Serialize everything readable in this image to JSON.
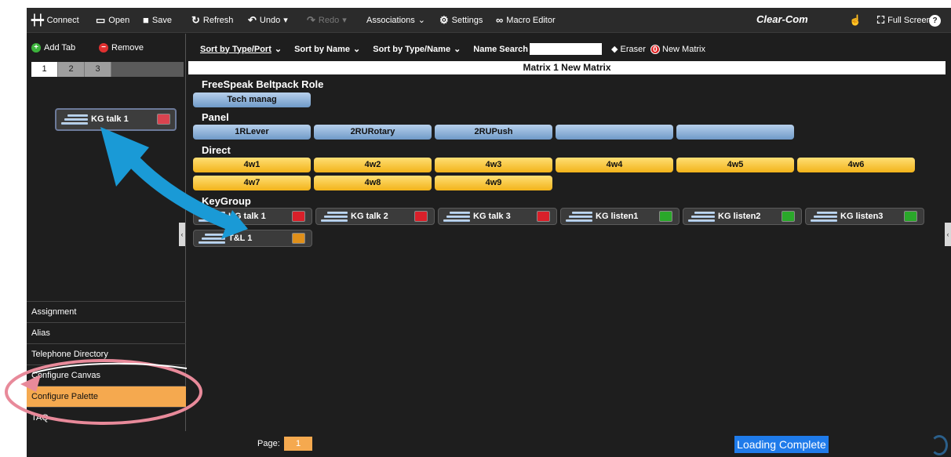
{
  "toolbar": {
    "connect": "Connect",
    "open": "Open",
    "save": "Save",
    "refresh": "Refresh",
    "undo": "Undo",
    "redo": "Redo",
    "associations": "Associations",
    "settings": "Settings",
    "macro_editor": "Macro Editor",
    "brand": "Clear-Com",
    "full_screen": "Full Screen",
    "help": "?"
  },
  "left_panel": {
    "add_tab": "Add Tab",
    "remove": "Remove",
    "tabs": [
      "1",
      "2",
      "3"
    ],
    "palette_key": "KG talk 1",
    "menu": [
      "Assignment",
      "Alias",
      "Telephone Directory",
      "Configure Canvas",
      "Configure Palette",
      "TAQ"
    ],
    "active_menu": "Configure Palette"
  },
  "sortbar": {
    "sort_type_port": "Sort by Type/Port",
    "sort_name": "Sort by Name",
    "sort_type_name": "Sort by Type/Name",
    "name_search": "Name Search",
    "name_search_value": "",
    "eraser": "Eraser",
    "new_matrix": "New Matrix",
    "new_matrix_badge": "0"
  },
  "matrix_title": "Matrix 1 New Matrix",
  "sections": {
    "freespeak": {
      "title": "FreeSpeak Beltpack Role",
      "keys": [
        "Tech manag"
      ]
    },
    "panel": {
      "title": "Panel",
      "keys": [
        "1RLever",
        "2RURotary",
        "2RUPush",
        "",
        ""
      ]
    },
    "direct": {
      "title": "Direct",
      "row1": [
        "4w1",
        "4w2",
        "4w3",
        "4w4",
        "4w5",
        "4w6"
      ],
      "row2": [
        "4w7",
        "4w8",
        "4w9"
      ]
    },
    "keygroup": {
      "title": "KeyGroup",
      "keys": [
        {
          "label": "KG talk 1",
          "color": "#d9202a"
        },
        {
          "label": "KG talk 2",
          "color": "#d9202a"
        },
        {
          "label": "KG talk 3",
          "color": "#d9202a"
        },
        {
          "label": "KG listen1",
          "color": "#2aa82a"
        },
        {
          "label": "KG listen2",
          "color": "#2aa82a"
        },
        {
          "label": "KG listen3",
          "color": "#2aa82a"
        },
        {
          "label": "T&L 1",
          "color": "#e0901a"
        }
      ]
    }
  },
  "status": {
    "page_label": "Page:",
    "page_value": "1",
    "loading": "Loading Complete"
  },
  "colors": {
    "accent_orange": "#f5a94f",
    "arrow_blue": "#1a9ad6",
    "highlight_ring": "#e88a9a"
  }
}
